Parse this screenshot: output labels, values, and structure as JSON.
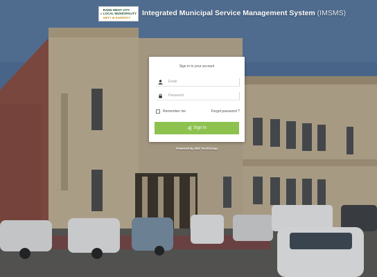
{
  "header": {
    "logo": {
      "line1": "RAND WEST CITY",
      "line2": "LOCAL MUNICIPALITY",
      "line3": "UNITY IN DIVERSITY"
    },
    "title": "Integrated Municipal Service Management System",
    "abbreviation": "(IMSMS)"
  },
  "login": {
    "subtitle": "Sign in to your account",
    "email_placeholder": "Email",
    "password_placeholder": "Password",
    "remember_label": "Remember me",
    "forgot_label": "Forgot password ?",
    "signin_label": "Sign In",
    "remember_checked": false
  },
  "footer": {
    "powered_by": "Powered By IMS TechGroup"
  },
  "colors": {
    "sky": "#4f6d95",
    "building": "#c9b89a",
    "brick": "#8a4a3d",
    "accent_green": "#8dc24f"
  }
}
